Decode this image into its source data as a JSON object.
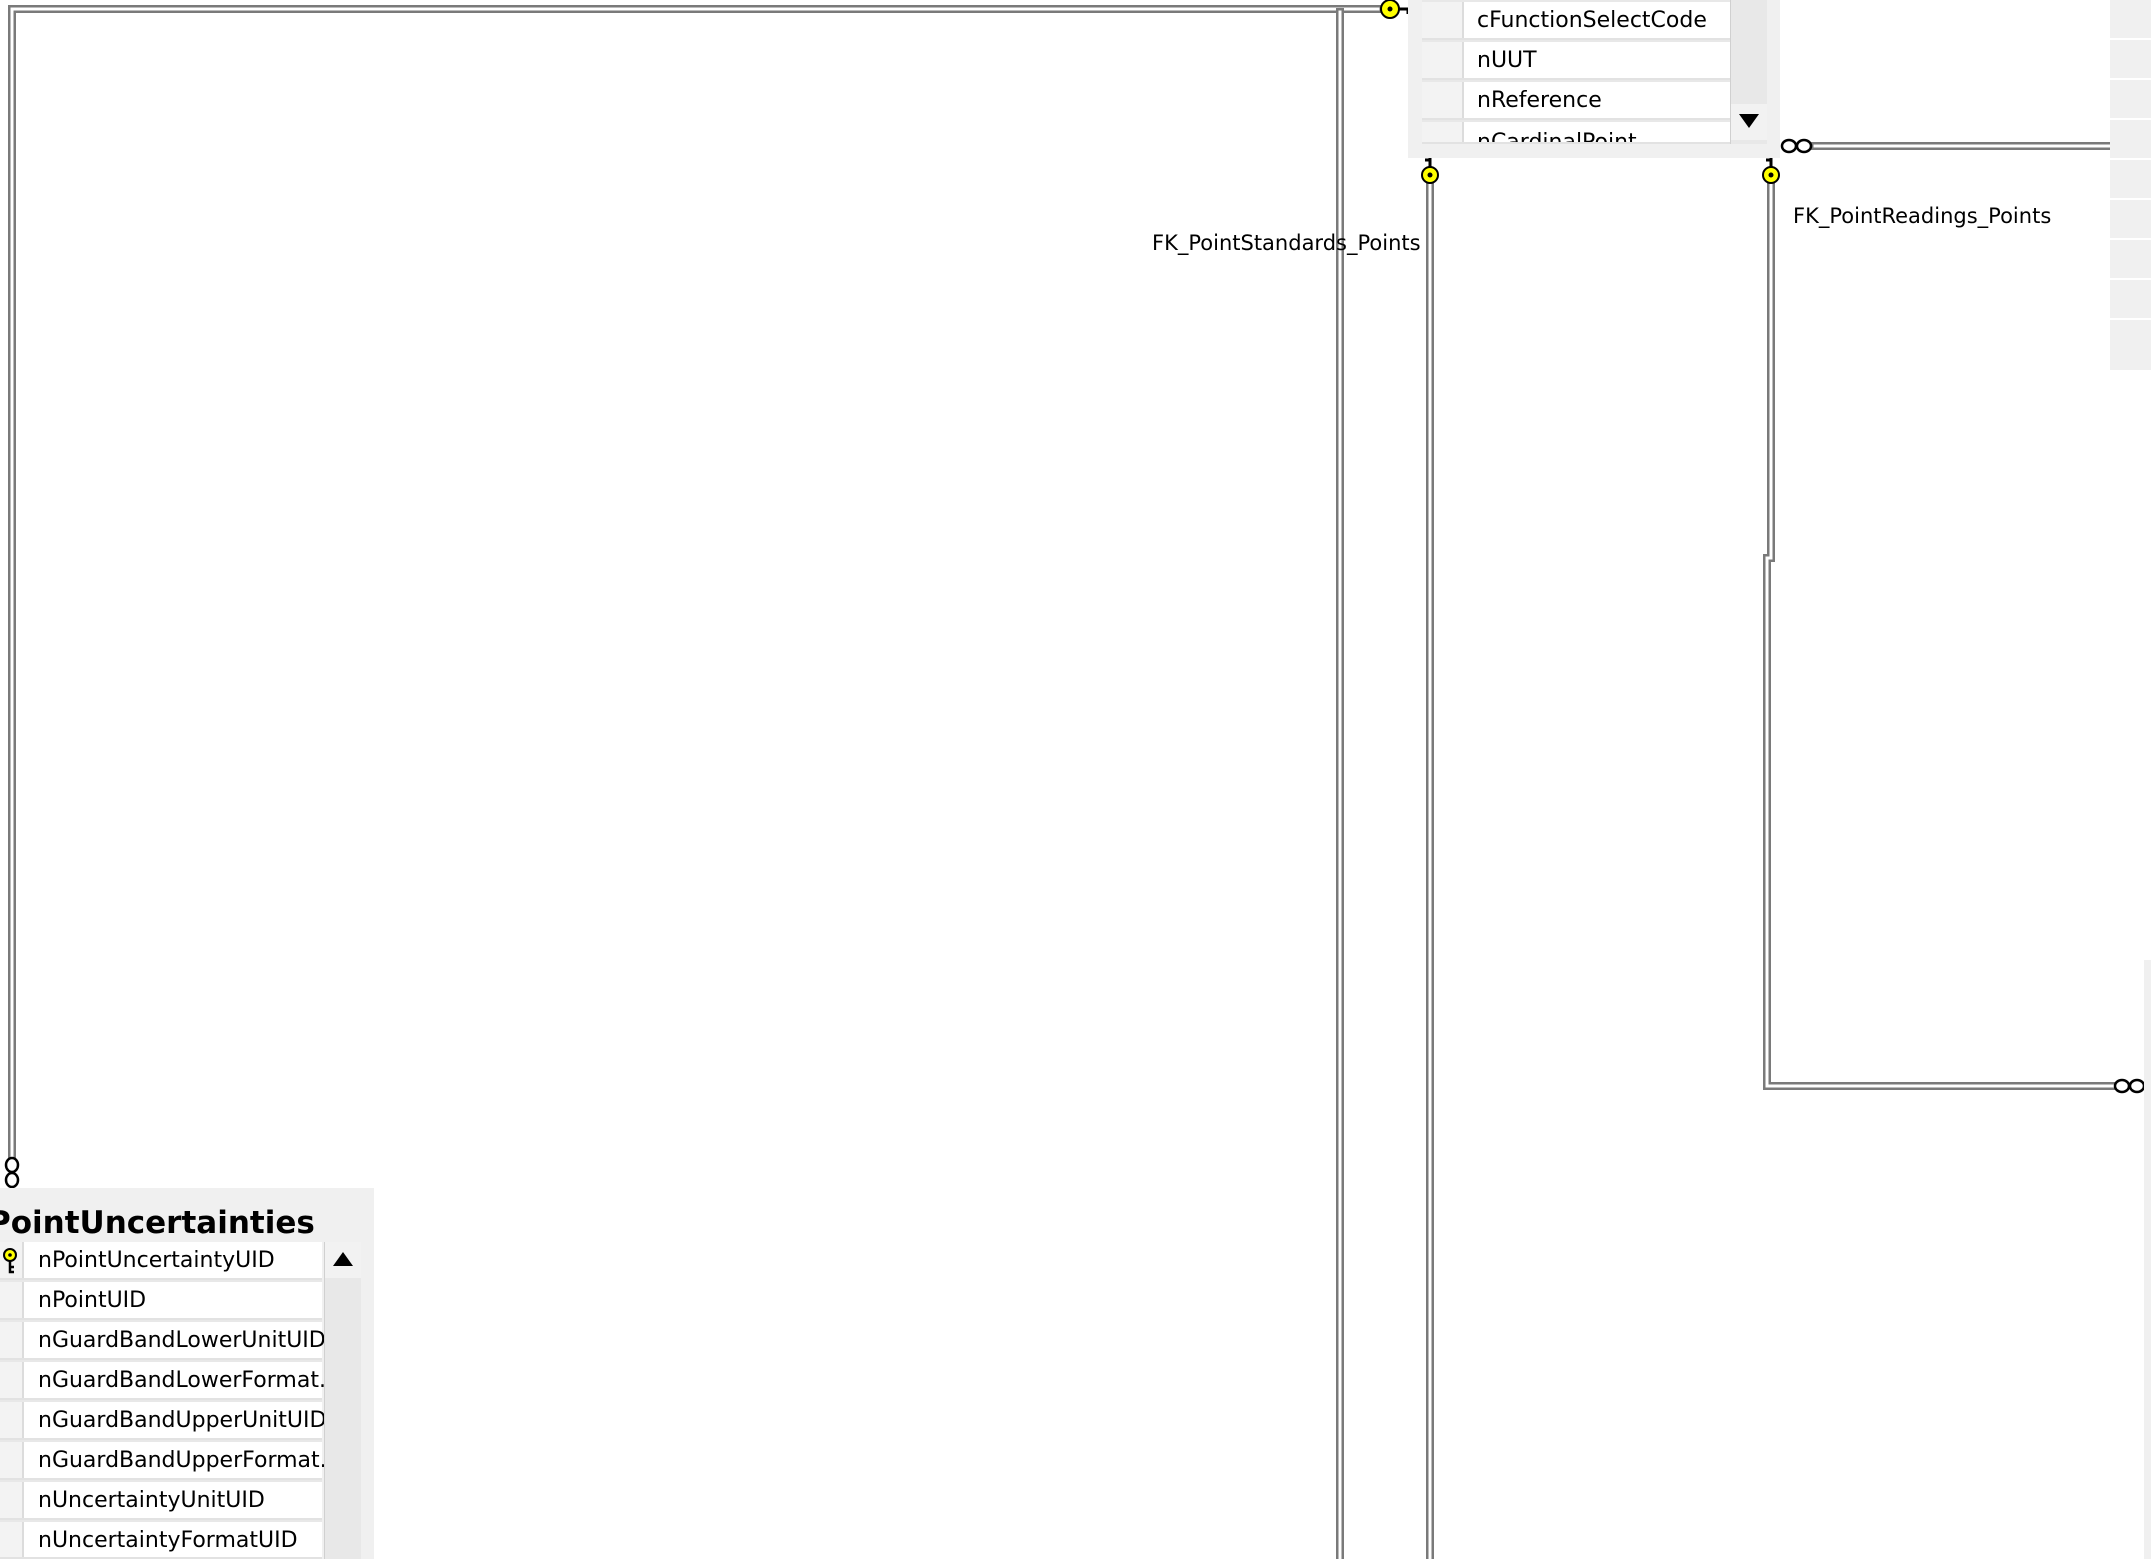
{
  "relationships": [
    {
      "label": "FK_PointStandards_Points"
    },
    {
      "label": "FK_PointReadings_Points"
    }
  ],
  "points_table": {
    "columns": [
      "cFunctionSelectCode",
      "nUUT",
      "nReference",
      "nCardinalPoint"
    ]
  },
  "point_uncertainties_table": {
    "title": "PointUncertainties",
    "columns": [
      {
        "name": "nPointUncertaintyUID",
        "primary_key": true
      },
      {
        "name": "nPointUID"
      },
      {
        "name": "nGuardBandLowerUnitUID"
      },
      {
        "name": "nGuardBandLowerFormat..."
      },
      {
        "name": "nGuardBandUpperUnitUID"
      },
      {
        "name": "nGuardBandUpperFormat..."
      },
      {
        "name": "nUncertaintyUnitUID"
      },
      {
        "name": "nUncertaintyFormatUID"
      }
    ]
  },
  "icons": {
    "key": "key-icon",
    "many": "infinity-icon",
    "scroll_up": "scroll-up-arrow-icon",
    "scroll_down": "scroll-down-arrow-icon"
  },
  "colors": {
    "canvas": "#ffffff",
    "table_background": "#f0f0f0",
    "connector_line": "#808080",
    "key_fill": "#ffff00"
  }
}
